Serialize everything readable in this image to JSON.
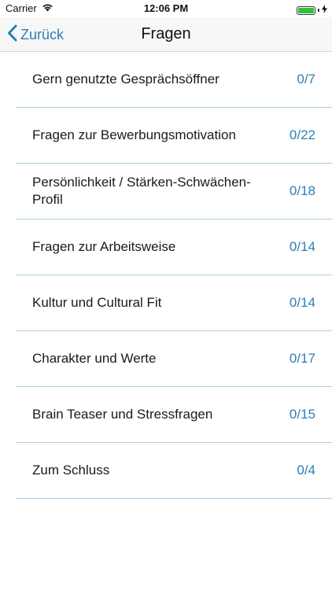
{
  "status_bar": {
    "carrier": "Carrier",
    "time": "12:06 PM",
    "wifi_icon": "wifi-icon",
    "battery_icon": "battery-icon",
    "charging_icon": "charging-bolt-icon",
    "battery_level": 1.0
  },
  "nav": {
    "back_label": "Zurück",
    "back_icon": "chevron-left-icon",
    "title": "Fragen",
    "accent_color": "#2c7fb6"
  },
  "categories": [
    {
      "label": "Gern genutzte Gesprächsöffner",
      "count": "0/7"
    },
    {
      "label": "Fragen zur Bewerbungsmotivation",
      "count": "0/22"
    },
    {
      "label": "Persönlichkeit / Stärken-Schwächen-Profil",
      "count": "0/18"
    },
    {
      "label": "Fragen zur Arbeitsweise",
      "count": "0/14"
    },
    {
      "label": "Kultur und Cultural Fit",
      "count": "0/14"
    },
    {
      "label": "Charakter und Werte",
      "count": "0/17"
    },
    {
      "label": "Brain Teaser und Stressfragen",
      "count": "0/15"
    },
    {
      "label": "Zum Schluss",
      "count": "0/4"
    }
  ]
}
